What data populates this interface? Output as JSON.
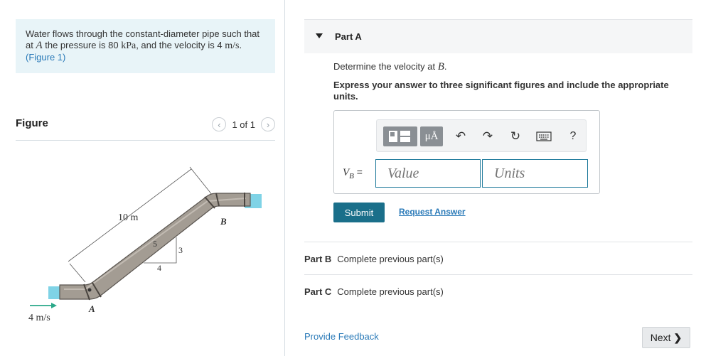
{
  "problem": {
    "text_1": "Water flows through the constant-diameter pipe such that",
    "text_2a": "at ",
    "point_a": "A",
    "text_2b": " the pressure is 80 ",
    "unit_kpa": "kPa",
    "text_2c": ", and the velocity is 4 ",
    "unit_ms": "m/s",
    "text_2d": ".",
    "fig_link": "(Figure 1)"
  },
  "figure": {
    "title": "Figure",
    "pager_text": "1 of 1",
    "prev_icon": "chevron-left-icon",
    "next_icon": "chevron-right-icon",
    "labels": {
      "length": "10 m",
      "point_b": "B",
      "point_a": "A",
      "slope_rise": "3",
      "slope_hyp": "5",
      "slope_run": "4",
      "velocity": "4 m/s"
    },
    "colors": {
      "pipe": "#9e9890",
      "water": "#7fd3e6",
      "arrow": "#2aa889"
    }
  },
  "partA": {
    "label": "Part A",
    "question_pre": "Determine the velocity at ",
    "question_var": "B",
    "question_post": ".",
    "instructions": "Express your answer to three significant figures and include the appropriate units.",
    "toolbar": {
      "templates_icon": "templates-icon",
      "units_symbol": "μÅ",
      "undo_icon": "undo-icon",
      "redo_icon": "redo-icon",
      "reset_icon": "reset-icon",
      "keyboard_icon": "keyboard-icon",
      "help_symbol": "?"
    },
    "eq_var": "V",
    "eq_sub": "B",
    "eq_sign": "=",
    "value_placeholder": "Value",
    "units_placeholder": "Units",
    "submit_label": "Submit",
    "request_label": "Request Answer"
  },
  "partB": {
    "label": "Part B",
    "status": "Complete previous part(s)"
  },
  "partC": {
    "label": "Part C",
    "status": "Complete previous part(s)"
  },
  "footer": {
    "feedback": "Provide Feedback",
    "next_label": "Next"
  }
}
